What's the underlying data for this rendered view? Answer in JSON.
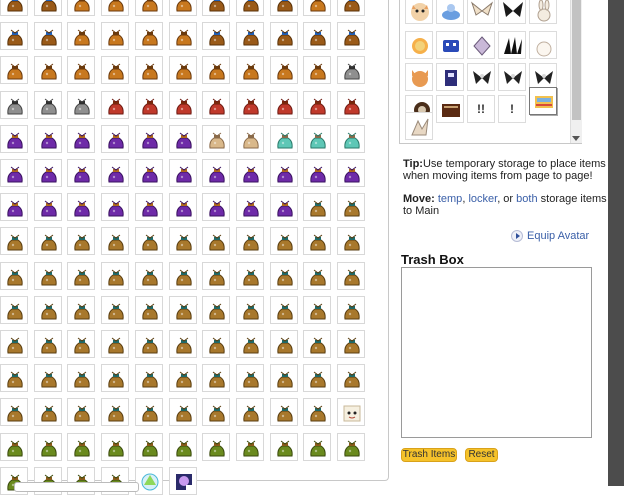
{
  "grid": {
    "rows": [
      {
        "bags": [
          "b",
          "b",
          "o",
          "o",
          "o",
          "o",
          "b",
          "b",
          "b",
          "o",
          "b"
        ]
      },
      {
        "bags": [
          "b",
          "b",
          "o",
          "o",
          "o",
          "o",
          "b",
          "b",
          "b",
          "b",
          "b"
        ]
      },
      {
        "bags": [
          "o",
          "o",
          "o",
          "o",
          "o",
          "o",
          "o",
          "o",
          "o",
          "o",
          "x"
        ]
      },
      {
        "bags": [
          "x",
          "x",
          "x",
          "r",
          "r",
          "r",
          "r",
          "r",
          "r",
          "r",
          "r"
        ]
      },
      {
        "bags": [
          "p",
          "p",
          "p",
          "p",
          "p",
          "p",
          "t",
          "t",
          "c",
          "c",
          "c"
        ]
      },
      {
        "bags": [
          "p",
          "p",
          "p",
          "p",
          "p",
          "p",
          "p",
          "p",
          "p",
          "p",
          "p"
        ]
      },
      {
        "bags": [
          "p",
          "p",
          "p",
          "p",
          "p",
          "p",
          "p",
          "p",
          "p",
          "g",
          "g"
        ]
      },
      {
        "bags": [
          "g",
          "g",
          "g",
          "g",
          "g",
          "g",
          "g",
          "g",
          "g",
          "g",
          "g"
        ]
      },
      {
        "bags": [
          "g",
          "g",
          "g",
          "g",
          "g",
          "g",
          "g",
          "g",
          "g",
          "g",
          "g"
        ]
      },
      {
        "bags": [
          "g",
          "g",
          "g",
          "g",
          "g",
          "g",
          "g",
          "g",
          "g",
          "g",
          "g"
        ]
      },
      {
        "bags": [
          "g",
          "g",
          "g",
          "g",
          "g",
          "g",
          "g",
          "g",
          "g",
          "g",
          "g"
        ]
      },
      {
        "bags": [
          "g",
          "g",
          "g",
          "g",
          "g",
          "g",
          "g",
          "g",
          "g",
          "g",
          "g"
        ]
      },
      {
        "bags": [
          "g",
          "g",
          "g",
          "g",
          "g",
          "g",
          "g",
          "g",
          "g",
          "g",
          "f"
        ]
      },
      {
        "bags": [
          "m",
          "m",
          "m",
          "m",
          "m",
          "m",
          "m",
          "m",
          "m",
          "m",
          "m"
        ]
      },
      {
        "bags": [
          "m",
          "m",
          "m",
          "m",
          "s",
          "q"
        ]
      }
    ],
    "bag_colors": {
      "b": {
        "sack": "#9a5a18",
        "knot": "#1f5fb8",
        "dark": "#5a3208"
      },
      "o": {
        "sack": "#c8781e",
        "knot": "#6b3a0d",
        "dark": "#6b3a0d"
      },
      "x": {
        "sack": "#8f8f8f",
        "knot": "#2e2e2e",
        "dark": "#444444"
      },
      "r": {
        "sack": "#c0392b",
        "knot": "#7a2a0c",
        "dark": "#6e1a12"
      },
      "p": {
        "sack": "#6e2aa8",
        "knot": "#b06a1a",
        "dark": "#3a1260"
      },
      "t": {
        "sack": "#d9b88a",
        "knot": "#8a6a4a",
        "dark": "#8a6a4a"
      },
      "c": {
        "sack": "#5ec7b6",
        "knot": "#8a6a4a",
        "dark": "#2a7a6a"
      },
      "g": {
        "sack": "#a8782c",
        "knot": "#1e6a6a",
        "dark": "#5a3e10"
      },
      "m": {
        "sack": "#6a8a1e",
        "knot": "#8a5a1a",
        "dark": "#3a4a0c"
      }
    }
  },
  "tip": {
    "label": "Tip:",
    "text": "Use temporary storage to place items when moving items from page to page!"
  },
  "move": {
    "label": "Move:",
    "temp": "temp",
    "comma1": ",",
    "locker": "locker",
    "or": ", or",
    "both": "both",
    "suffix": "storage items to Main"
  },
  "equip_label": "Equip Avatar",
  "trash": {
    "title": "Trash Box",
    "trash_button": "Trash Items",
    "reset_button": "Reset"
  },
  "item_box": {
    "bang_label": "!!",
    "bang_label_single": "!"
  }
}
